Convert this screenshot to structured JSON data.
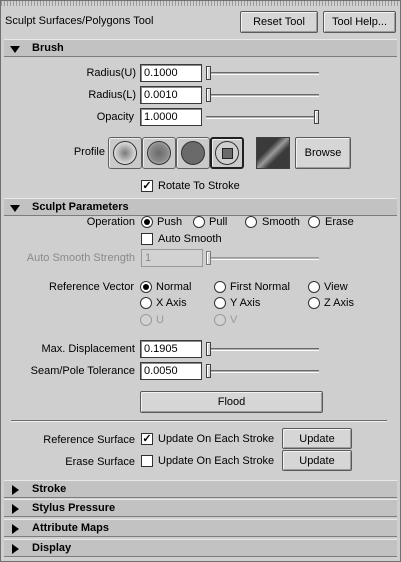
{
  "header": {
    "title": "Sculpt Surfaces/Polygons Tool",
    "reset_label": "Reset Tool",
    "help_label": "Tool Help..."
  },
  "brush": {
    "title": "Brush",
    "radius_u": {
      "label": "Radius(U)",
      "value": "0.1000",
      "fraction": 0.0
    },
    "radius_l": {
      "label": "Radius(L)",
      "value": "0.0010",
      "fraction": 0.0
    },
    "opacity": {
      "label": "Opacity",
      "value": "1.0000",
      "fraction": 1.0
    },
    "profile_label": "Profile",
    "profiles": [
      "gaussian-profile-icon",
      "soft-profile-icon",
      "solid-profile-icon",
      "square-profile-icon"
    ],
    "browse_label": "Browse",
    "rotate_label": "Rotate To Stroke",
    "rotate_checked": true
  },
  "sculpt": {
    "title": "Sculpt Parameters",
    "operation_label": "Operation",
    "operations": [
      {
        "label": "Push",
        "selected": true
      },
      {
        "label": "Pull",
        "selected": false
      },
      {
        "label": "Smooth",
        "selected": false
      },
      {
        "label": "Erase",
        "selected": false
      }
    ],
    "auto_smooth_label": "Auto Smooth",
    "auto_smooth_checked": false,
    "auto_smooth_strength_label": "Auto Smooth Strength",
    "auto_smooth_strength_value": "1",
    "ref_vector_label": "Reference Vector",
    "ref_vectors": {
      "normal": "Normal",
      "first_normal": "First Normal",
      "view": "View",
      "x_axis": "X Axis",
      "y_axis": "Y Axis",
      "z_axis": "Z Axis",
      "u": "U",
      "v": "V"
    },
    "max_disp": {
      "label": "Max. Displacement",
      "value": "0.1905",
      "fraction": 0.0
    },
    "seam": {
      "label": "Seam/Pole Tolerance",
      "value": "0.0050",
      "fraction": 0.0
    },
    "flood_label": "Flood",
    "ref_surface_label": "Reference Surface",
    "erase_surface_label": "Erase Surface",
    "update_each_stroke_label": "Update On Each Stroke",
    "ref_update_checked": true,
    "erase_update_checked": false,
    "update_label": "Update"
  },
  "collapsed_sections": [
    {
      "label": "Stroke"
    },
    {
      "label": "Stylus Pressure"
    },
    {
      "label": "Attribute Maps"
    },
    {
      "label": "Display"
    }
  ]
}
